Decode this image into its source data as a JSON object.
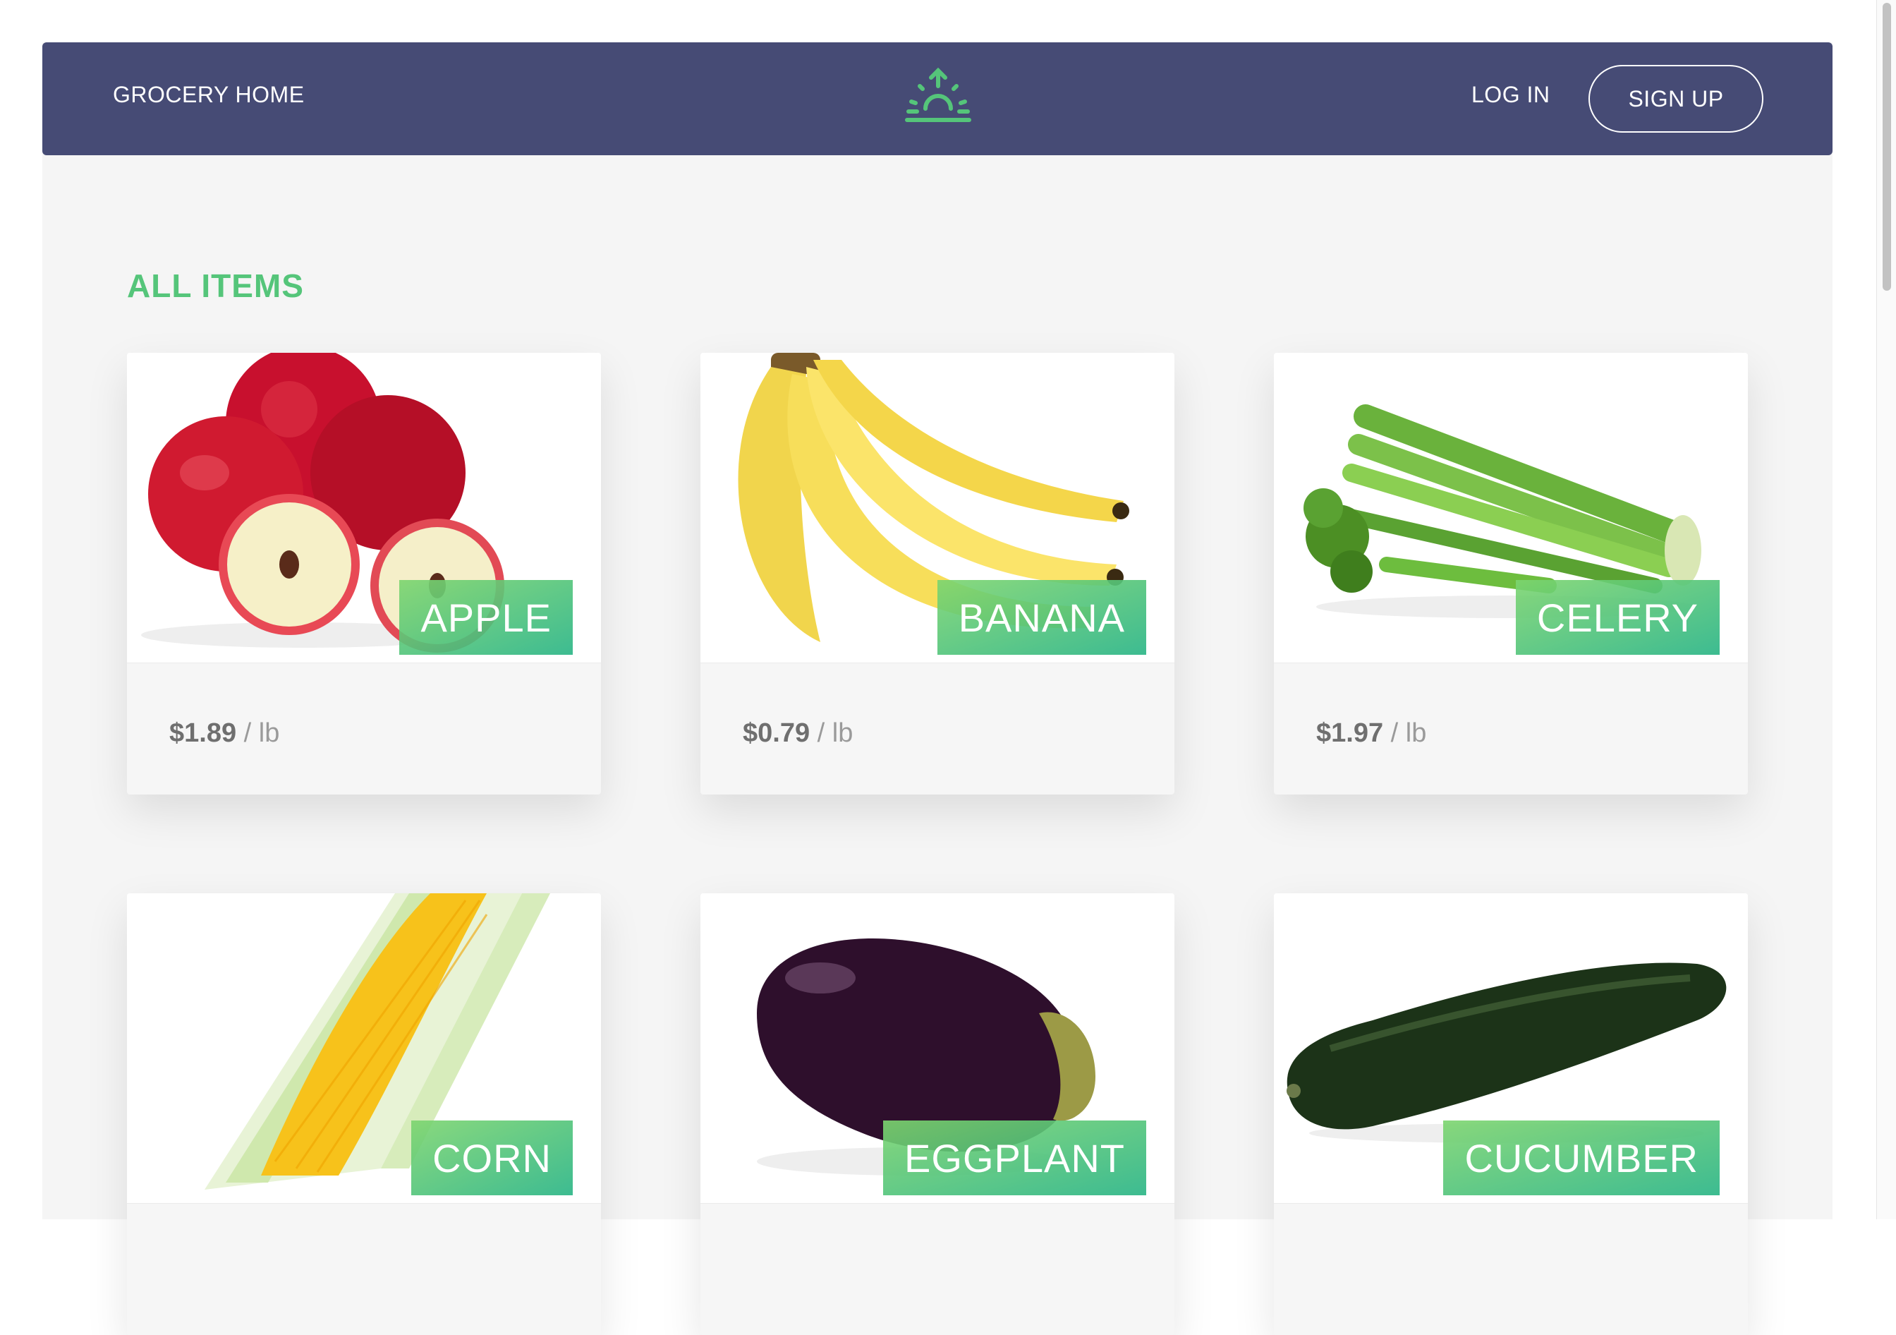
{
  "navbar": {
    "home_label": "GROCERY HOME",
    "login_label": "LOG IN",
    "signup_label": "SIGN UP",
    "logo_icon": "sunrise-logo-icon",
    "background": "#464b75",
    "logo_color": "#55c57a"
  },
  "section": {
    "title": "ALL ITEMS",
    "title_color": "#55c57a"
  },
  "items": [
    {
      "name": "APPLE",
      "price": "$1.89",
      "unit": "/ lb",
      "icon": "apple-image"
    },
    {
      "name": "BANANA",
      "price": "$0.79",
      "unit": "/ lb",
      "icon": "banana-image"
    },
    {
      "name": "CELERY",
      "price": "$1.97",
      "unit": "/ lb",
      "icon": "celery-image"
    },
    {
      "name": "CORN",
      "icon": "corn-image"
    },
    {
      "name": "EGGPLANT",
      "icon": "eggplant-image"
    },
    {
      "name": "CUCUMBER",
      "icon": "cucumber-image"
    }
  ],
  "accent_colors": [
    "#7dd56f",
    "#28b485"
  ]
}
